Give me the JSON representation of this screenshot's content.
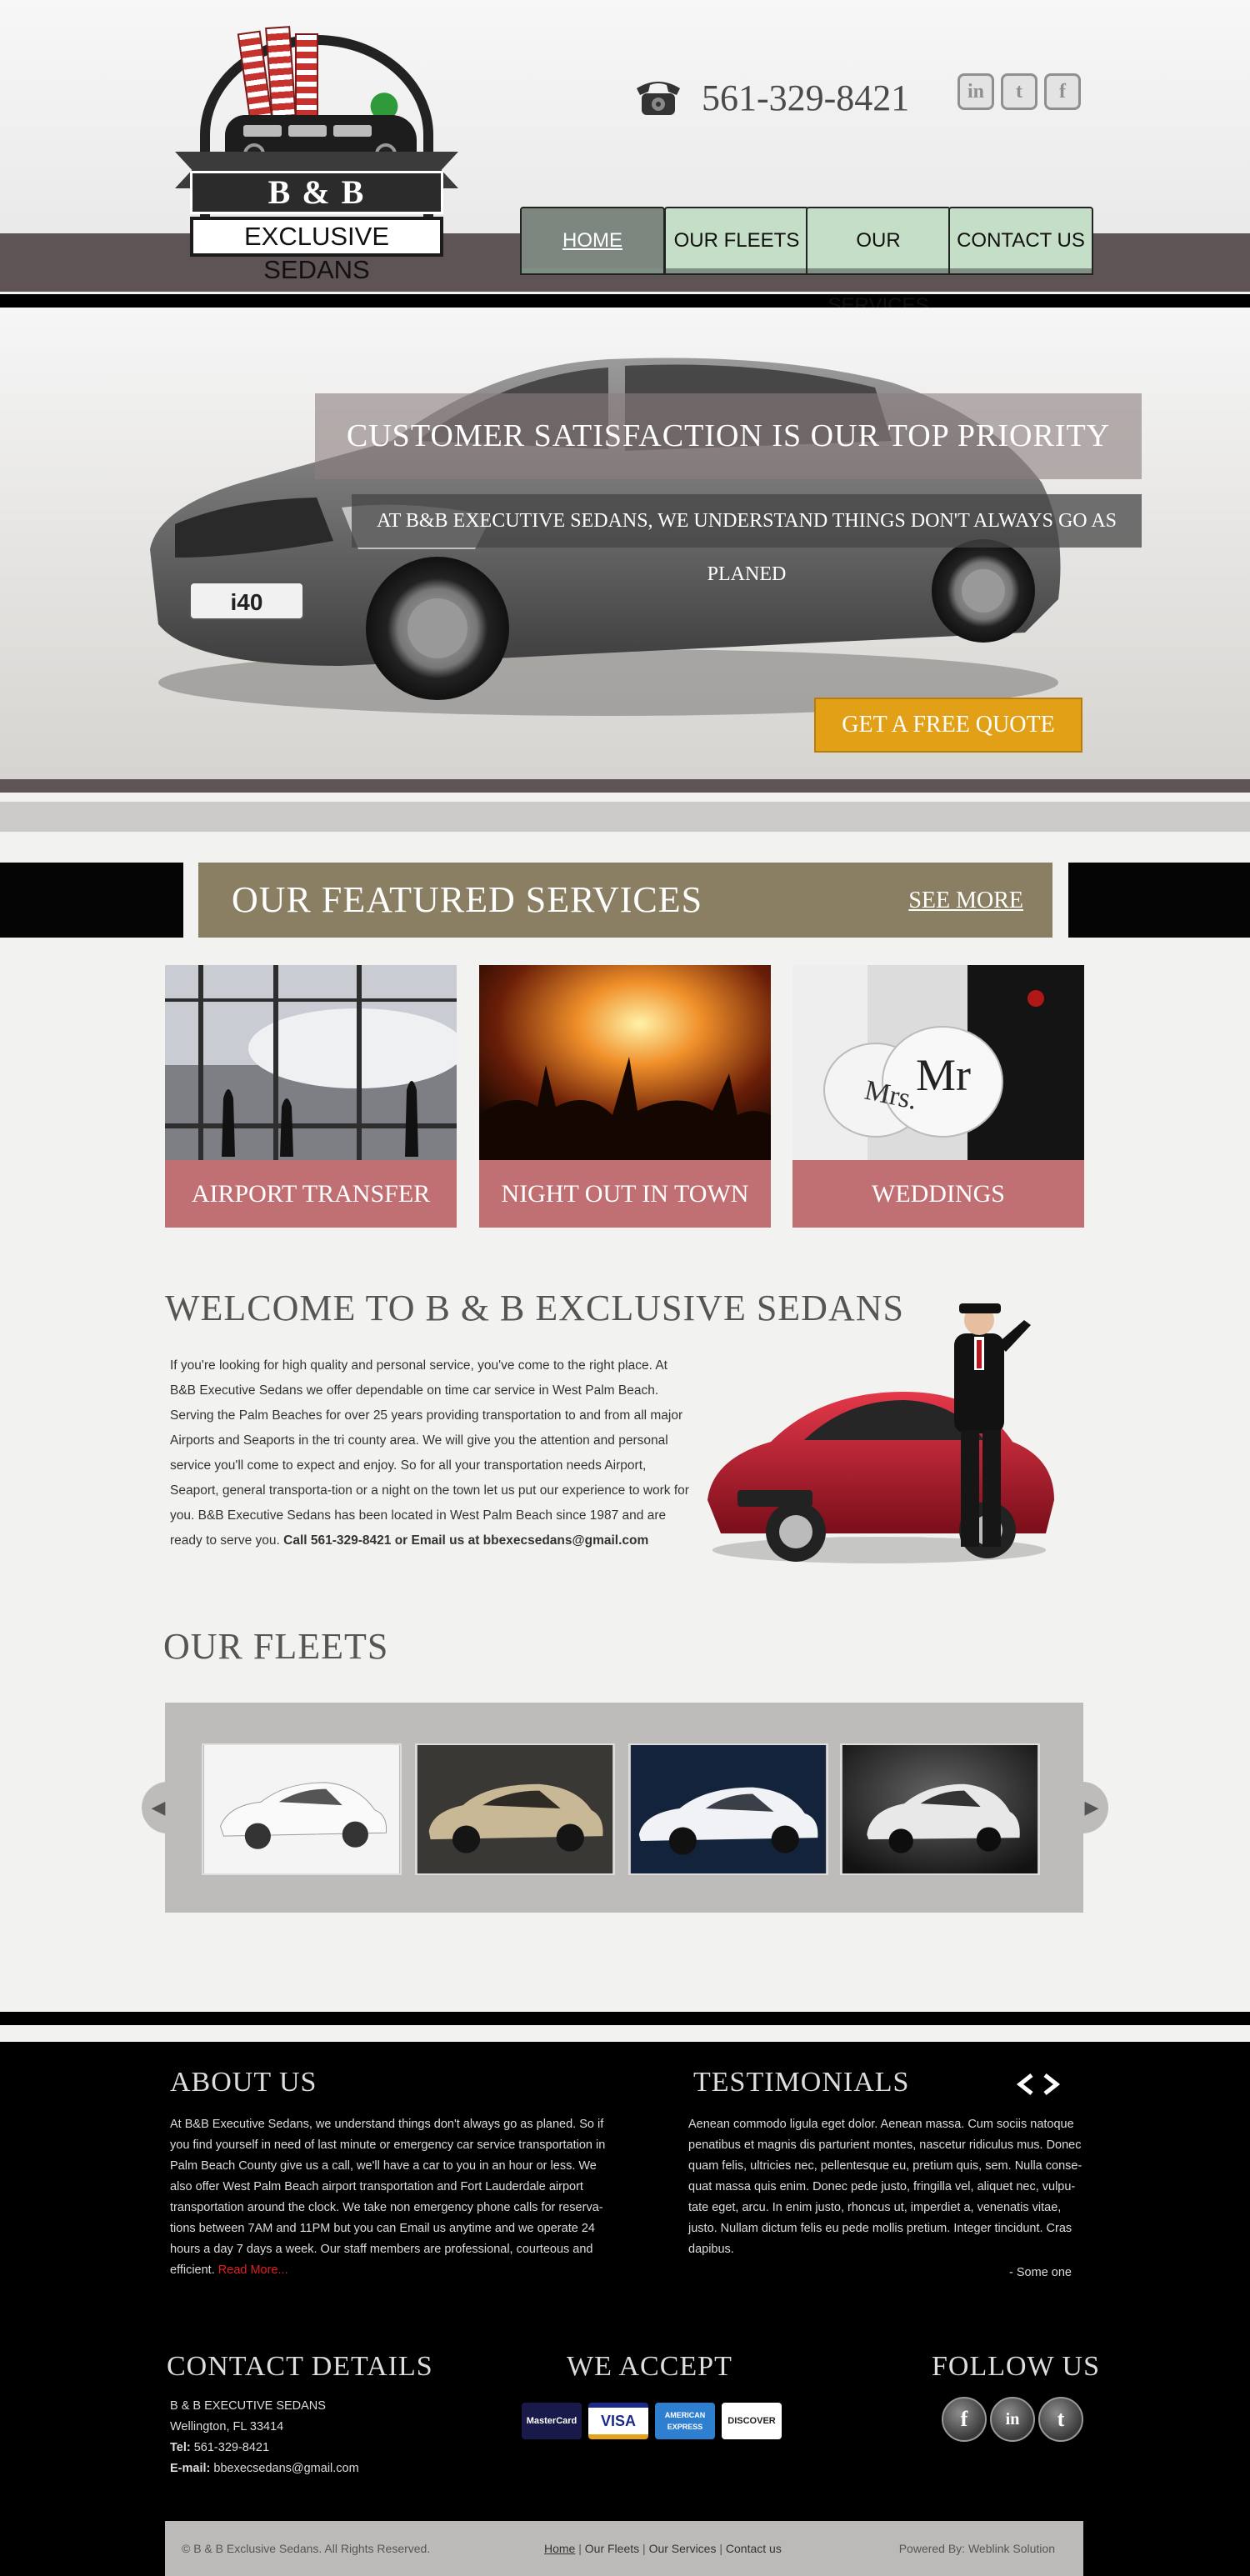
{
  "header": {
    "logo_name": "B & B",
    "logo_sub": "EXCLUSIVE SEDANS",
    "phone": "561-329-8421",
    "social": {
      "linkedin": "in",
      "twitter": "t",
      "facebook": "f"
    },
    "nav": [
      "HOME",
      "OUR FLEETS",
      "OUR SERVICES",
      "CONTACT US"
    ]
  },
  "hero": {
    "title": "CUSTOMER SATISFACTION IS OUR TOP PRIORITY",
    "subtitle": "AT B&B EXECUTIVE SEDANS, WE UNDERSTAND THINGS DON'T ALWAYS GO AS PLANED",
    "cta": "GET A FREE QUOTE",
    "plate": "i40"
  },
  "featured": {
    "title": "OUR FEATURED SERVICES",
    "see_more": "SEE MORE",
    "services": [
      "AIRPORT TRANSFER",
      "NIGHT OUT IN TOWN",
      "WEDDINGS"
    ],
    "wedding_sign_1": "Mrs.",
    "wedding_sign_2": "Mr"
  },
  "welcome": {
    "title": "WELCOME TO B & B EXCLUSIVE SEDANS",
    "body": "If you're looking for high quality and personal service, you've come to the right place. At B&B Executive Sedans we offer dependable on time car service in West Palm Beach. Serving the Palm Beaches for over 25 years providing transportation to and from all major Airports and Seaports in the tri county area. We will give you the attention and personal service you'll come to expect and enjoy. So for all your transportation needs Airport, Seaport, general transporta-tion or a night on the town let us put our experience to work for you. B&B Executive Sedans has been located in West Palm Beach since 1987 and are ready to serve you.",
    "call": "Call 561-329-8421 or Email us at bbexecsedans@gmail.com"
  },
  "fleets": {
    "title": "OUR FLEETS",
    "prev": "◀",
    "next": "▶"
  },
  "footer": {
    "about_title": "ABOUT US",
    "about_text": "At B&B Executive Sedans, we understand things don't always go as planed. So if you find yourself in need of last minute or emergency car service transportation in Palm Beach County give us a call, we'll have a car to you in an hour or less. We also offer West Palm Beach airport transportation and Fort Lauderdale airport transportation around the clock. We take non emergency phone calls for reserva-tions between 7AM and 11PM but you can Email us anytime and we operate 24 hours a day 7 days a week. Our staff members are professional, courteous and efficient.",
    "read_more": "Read More...",
    "testimonials_title": "TESTIMONIALS",
    "testimonial_text": "Aenean commodo ligula eget dolor. Aenean massa. Cum sociis natoque penatibus et magnis dis parturient montes, nascetur ridiculus mus. Donec quam felis, ultricies nec, pellentesque eu, pretium quis, sem. Nulla conse-quat massa quis enim. Donec pede justo, fringilla vel, aliquet nec, vulpu-tate eget, arcu. In enim justo, rhoncus ut, imperdiet a, venenatis vitae, justo. Nullam dictum felis eu pede mollis pretium. Integer tincidunt. Cras dapibus.",
    "testimonial_author": "- Some one",
    "contact_title": "CONTACT DETAILS",
    "contact_name": "B & B EXECUTIVE SEDANS",
    "contact_city": "Wellington, FL 33414",
    "tel_label": "Tel:",
    "tel": "561-329-8421",
    "email_label": "E-mail:",
    "email": "bbexecsedans@gmail.com",
    "accept_title": "WE ACCEPT",
    "cards": [
      "MasterCard",
      "VISA",
      "AMERICAN EXPRESS",
      "DISCOVER"
    ],
    "follow_title": "FOLLOW US",
    "follow_icons": [
      "f",
      "in",
      "t"
    ],
    "copyright": "© B & B Exclusive Sedans. All Rights Reserved.",
    "links": [
      "Home",
      "Our Fleets",
      "Our Services",
      "Contact us"
    ],
    "separator": "|",
    "powered": "Powered By: Weblink Solution"
  },
  "colors": {
    "band": "#5e5455",
    "nav_tab": "#c5dec8",
    "featured_bar": "#8a7f62",
    "service_label": "#c07073",
    "cta": "#e2a017"
  },
  "icons": [
    "phone-icon",
    "linkedin-icon",
    "twitter-icon",
    "facebook-icon",
    "chevron-left-icon",
    "chevron-right-icon",
    "facebook-round-icon",
    "linkedin-round-icon",
    "twitter-round-icon"
  ]
}
